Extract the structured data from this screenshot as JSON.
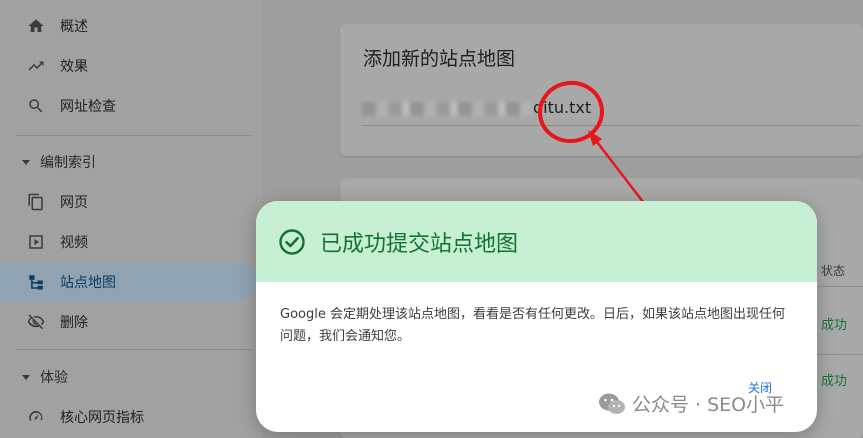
{
  "sidebar": {
    "items": [
      {
        "label": "概述",
        "icon": "home-icon"
      },
      {
        "label": "效果",
        "icon": "trending-icon"
      },
      {
        "label": "网址检查",
        "icon": "search-icon"
      }
    ],
    "section_index": {
      "label": "编制索引"
    },
    "index_items": [
      {
        "label": "网页",
        "icon": "pages-icon"
      },
      {
        "label": "视频",
        "icon": "video-icon"
      },
      {
        "label": "站点地图",
        "icon": "sitemap-icon",
        "active": true
      },
      {
        "label": "删除",
        "icon": "visibility-off-icon"
      }
    ],
    "section_experience": {
      "label": "体验"
    },
    "experience_items": [
      {
        "label": "核心网页指标",
        "icon": "speed-icon"
      }
    ]
  },
  "main": {
    "add_sitemap": {
      "title": "添加新的站点地图",
      "input_value": "ditu.txt"
    },
    "table": {
      "status_header": "状态",
      "status_values": [
        "成功",
        "成功"
      ]
    }
  },
  "dialog": {
    "title": "已成功提交站点地图",
    "body": "Google 会定期处理该站点地图，看看是否有任何更改。日后，如果该站点地图出现任何问题，我们会通知您。",
    "close_label": "关闭"
  },
  "watermark": {
    "text": "公众号 · SEO小平"
  },
  "colors": {
    "dialog_header_bg": "#c6efd4",
    "success_green": "#137333",
    "link_blue": "#1a73e8",
    "annotation_red": "#e8161c"
  }
}
